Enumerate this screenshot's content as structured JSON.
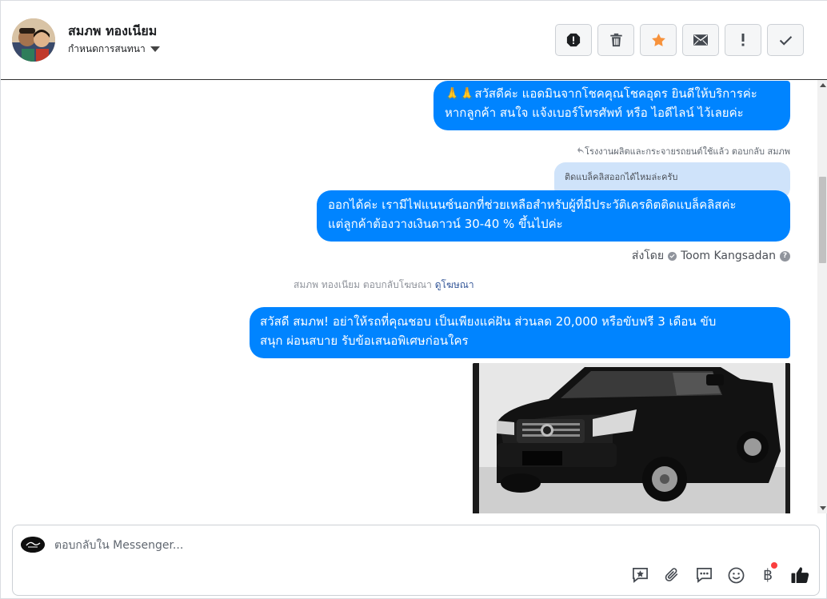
{
  "header": {
    "contact_name": "สมภพ ทองเนียม",
    "assign_label": "กำหนดการสนทนา",
    "actions": [
      {
        "icon": "alert-circle-icon",
        "label": "Mark as spam"
      },
      {
        "icon": "trash-icon",
        "label": "Delete"
      },
      {
        "icon": "star-icon",
        "label": "Star"
      },
      {
        "icon": "envelope-icon",
        "label": "Mark as unread"
      },
      {
        "icon": "exclamation-icon",
        "label": "Follow up"
      },
      {
        "icon": "check-icon",
        "label": "Mark as done"
      }
    ]
  },
  "messages": {
    "greeting": "🙏🙏สวัสดีค่ะ แอดมินจากโชคคุณโชคอุดร ยินดีให้บริการค่ะ\nหากลูกค้า สนใจ แจ้งเบอร์โทรศัพท์ หรือ ไอดีไลน์  ไว้เลยค่ะ",
    "reply_meta": "โรงงานผลิตและกระจายรถยนต์ใช้แล้ว ตอบกลับ สมภพ",
    "quoted": "ติดแบล็คลิสออกได้ไหมล่ะครับ",
    "answer": "ออกได้ค่ะ เรามีไฟแนนซ์นอกที่ช่วยเหลือสำหรับผู้ที่มีประวัติเครดิตติดแบล็คลิสค่ะ\nแต่ลูกค้าต้องวางเงินดาวน์ 30-40 % ขึ้นไปค่ะ",
    "sent_by_label": "ส่งโดย",
    "sent_by_name": "Toom Kangsadan",
    "ad_meta": "สมภพ ทองเนียม ตอบกลับโฆษณา",
    "ad_link": "ดูโฆษณา",
    "promo": "สวัสดี สมภพ! อย่าให้รถที่คุณชอบ เป็นเพียงแค่ฝัน ส่วนลด 20,000 หรือขับฟรี 3 เดือน ขับ\nสนุก ผ่อนสบาย รับข้อเสนอพิเศษก่อนใคร"
  },
  "composer": {
    "placeholder": "ตอบกลับใน Messenger...",
    "tools": [
      "saved-reply-icon",
      "attachment-icon",
      "quick-reply-icon",
      "emoji-icon",
      "baht-payment-icon",
      "thumbs-up-icon"
    ],
    "baht_symbol": "฿"
  },
  "colors": {
    "bubble": "#0084ff",
    "quote_bg": "#cfe3fa",
    "star": "#f7923b",
    "link": "#365899",
    "notification_dot": "#fa3e3e"
  }
}
